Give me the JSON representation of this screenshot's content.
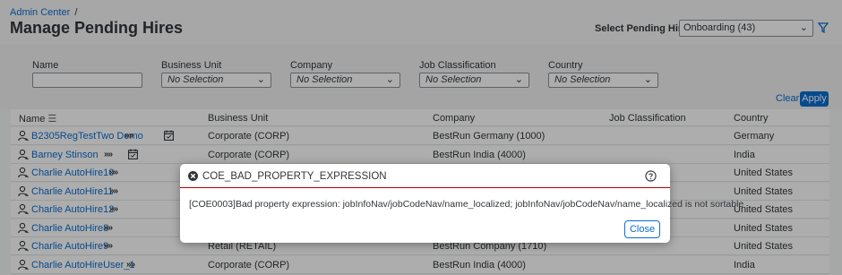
{
  "header": {
    "breadcrumb": "Admin Center",
    "breadcrumb_sep": "/",
    "title": "Manage Pending Hires",
    "select_label": "Select Pending Hires",
    "select_value": "Onboarding (43)",
    "filter_icon": "filter-icon"
  },
  "filters": {
    "name_label": "Name",
    "name_value": "",
    "business_unit_label": "Business Unit",
    "business_unit_value": "No Selection",
    "company_label": "Company",
    "company_value": "No Selection",
    "job_classification_label": "Job Classification",
    "job_classification_value": "No Selection",
    "country_label": "Country",
    "country_value": "No Selection",
    "clear_label": "Clear",
    "apply_label": "Apply"
  },
  "table": {
    "columns": {
      "name": "Name",
      "business_unit": "Business Unit",
      "company": "Company",
      "job_classification": "Job Classification",
      "country": "Country"
    },
    "rows": [
      {
        "name": "B2305RegTestTwo Demo",
        "business_unit": "Corporate (CORP)",
        "company": "BestRun Germany (1000)",
        "job_classification": "",
        "country": "Germany"
      },
      {
        "name": "Barney Stinson",
        "business_unit": "Corporate (CORP)",
        "company": "BestRun India (4000)",
        "job_classification": "",
        "country": "India"
      },
      {
        "name": "Charlie AutoHire10",
        "business_unit": "",
        "company": "",
        "job_classification": "",
        "country": "United States"
      },
      {
        "name": "Charlie AutoHire11",
        "business_unit": "",
        "company": "",
        "job_classification": "",
        "country": "United States"
      },
      {
        "name": "Charlie AutoHire12",
        "business_unit": "",
        "company": "",
        "job_classification": "",
        "country": "United States"
      },
      {
        "name": "Charlie AutoHire8",
        "business_unit": "",
        "company": "",
        "job_classification": "",
        "country": "United States"
      },
      {
        "name": "Charlie AutoHire9",
        "business_unit": "Retail (RETAIL)",
        "company": "BestRun Company (1710)",
        "job_classification": "",
        "country": "United States"
      },
      {
        "name": "Charlie AutoHireUser_1",
        "business_unit": "Corporate (CORP)",
        "company": "BestRun India (4000)",
        "job_classification": "",
        "country": "India"
      }
    ]
  },
  "dialog": {
    "title": "COE_BAD_PROPERTY_EXPRESSION",
    "message": "[COE0003]Bad property expression: jobInfoNav/jobCodeNav/name_localized; jobInfoNav/jobCodeNav/name_localized is not sortable",
    "close_label": "Close"
  },
  "colors": {
    "accent": "#0a6ed1",
    "error": "#bb0000"
  }
}
